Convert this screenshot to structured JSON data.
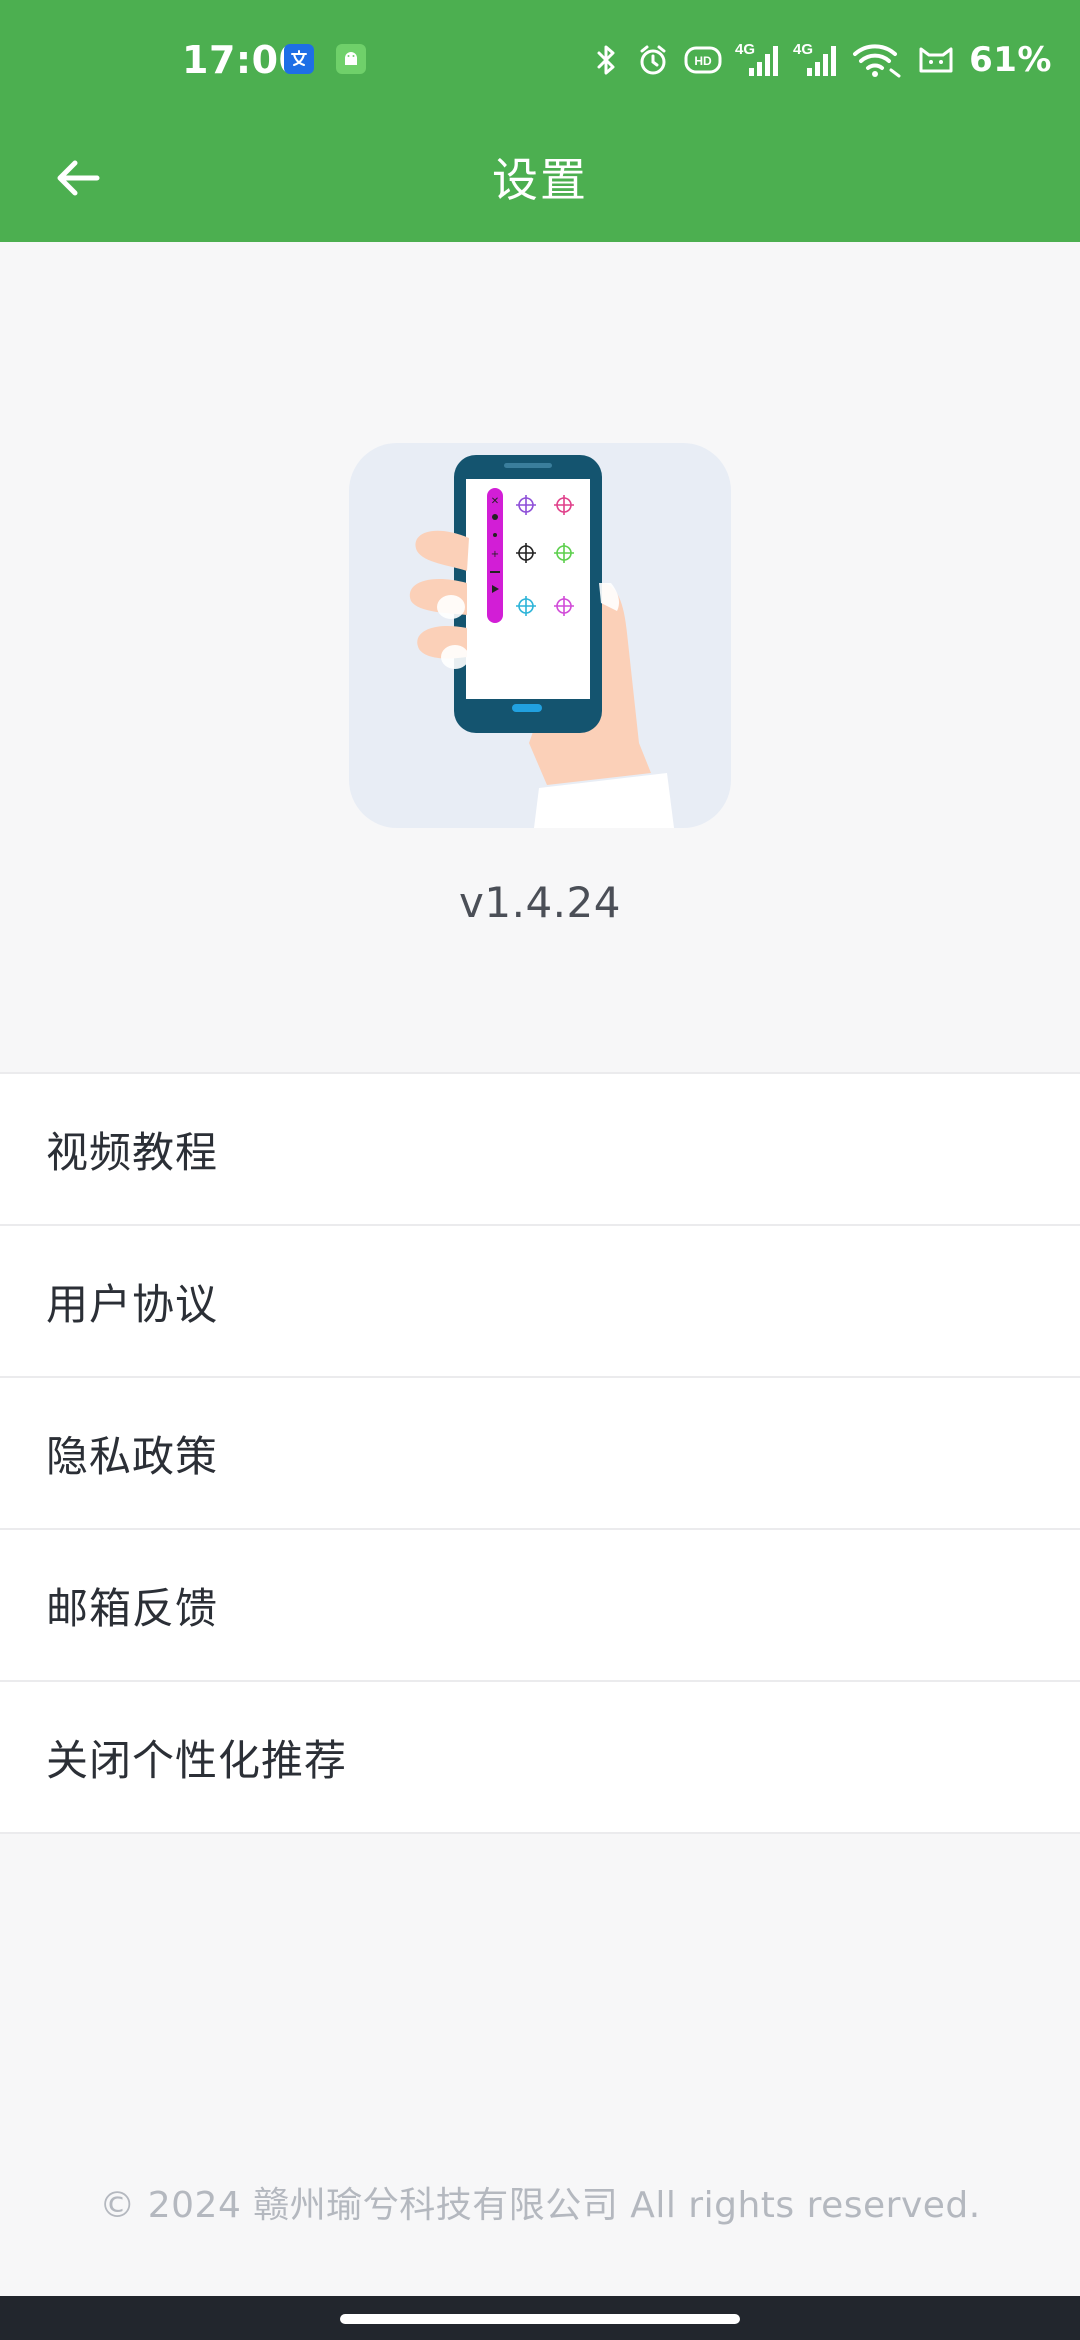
{
  "status_bar": {
    "time": "17:00",
    "battery": "61%",
    "network_1": "4G",
    "network_2": "4G",
    "icons": [
      "translate-app-icon",
      "android-app-icon",
      "bluetooth-icon",
      "alarm-icon",
      "hd-icon",
      "signal-4g-icon",
      "signal-4g-icon",
      "wifi-icon",
      "cat-face-icon",
      "battery-text"
    ]
  },
  "header": {
    "title": "设置",
    "back_icon": "arrow-left-icon",
    "background_color": "#4caf50"
  },
  "app_info": {
    "version": "v1.4.24",
    "logo_icon": "hand-holding-phone-icon"
  },
  "menu": {
    "items": [
      {
        "label": "视频教程"
      },
      {
        "label": "用户协议"
      },
      {
        "label": "隐私政策"
      },
      {
        "label": "邮箱反馈"
      },
      {
        "label": "关闭个性化推荐"
      }
    ]
  },
  "footer": {
    "copyright": "© 2024 赣州瑜兮科技有限公司 All rights reserved."
  },
  "colors": {
    "accent": "#4caf50",
    "page_background": "#f7f7f8",
    "list_background": "#ffffff",
    "text_primary": "#2b2f36",
    "text_muted": "#b4b8bf"
  }
}
